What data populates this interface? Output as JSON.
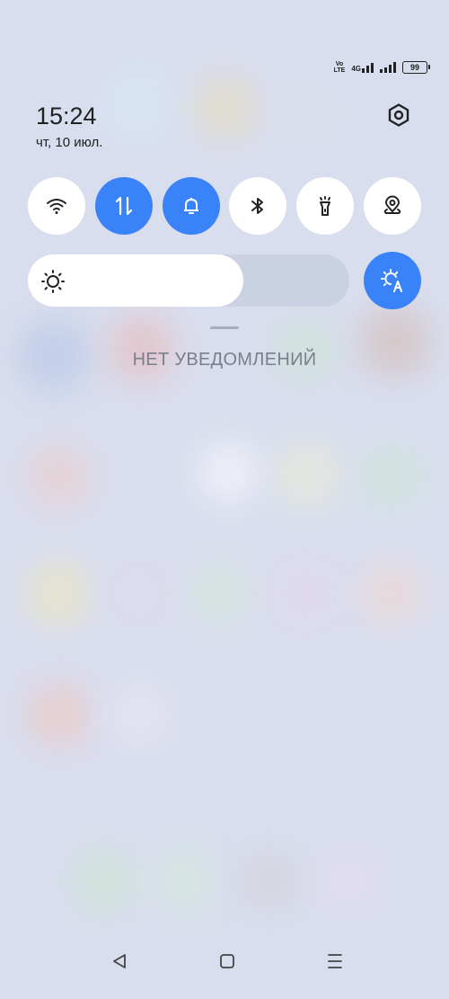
{
  "status_bar": {
    "volte_line1": "Vo",
    "volte_line2": "LTE",
    "network": "4G",
    "battery": "99"
  },
  "header": {
    "time": "15:24",
    "date": "чт, 10 июл."
  },
  "quick_tiles": [
    {
      "name": "wifi",
      "icon": "wifi-icon",
      "active": false
    },
    {
      "name": "mobile-data",
      "icon": "data-arrows-icon",
      "active": true
    },
    {
      "name": "sound",
      "icon": "bell-icon",
      "active": true
    },
    {
      "name": "bluetooth",
      "icon": "bluetooth-icon",
      "active": false
    },
    {
      "name": "flashlight",
      "icon": "flashlight-icon",
      "active": false
    },
    {
      "name": "location",
      "icon": "location-icon",
      "active": false
    }
  ],
  "brightness": {
    "level": 0.67,
    "icon": "sun-icon",
    "auto_icon": "auto-brightness-icon"
  },
  "notifications": {
    "empty_text": "НЕТ УВЕДОМЛЕНИЙ"
  },
  "colors": {
    "accent": "#3a82f7",
    "tile_inactive": "#ffffff"
  },
  "navbar": {
    "back_icon": "back-icon",
    "home_icon": "home-icon",
    "recents_icon": "menu-icon"
  }
}
